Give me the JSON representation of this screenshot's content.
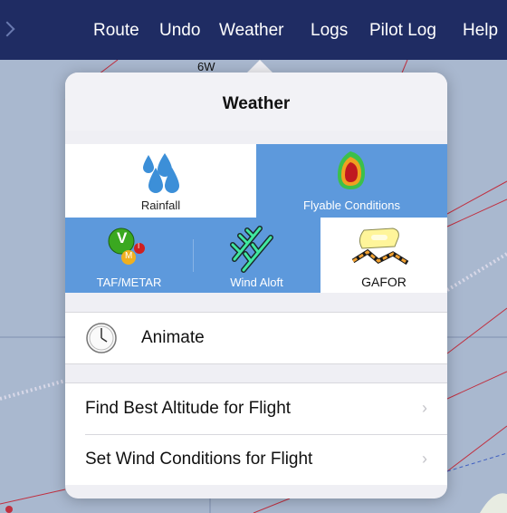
{
  "menu": {
    "items": [
      {
        "label": "Route"
      },
      {
        "label": "Undo"
      },
      {
        "label": "Weather"
      },
      {
        "label": "Logs"
      },
      {
        "label": "Pilot Log"
      },
      {
        "label": "Help"
      }
    ]
  },
  "map": {
    "label_6w": "6W"
  },
  "popover": {
    "title": "Weather",
    "tiles": {
      "rainfall": "Rainfall",
      "flyable": "Flyable Conditions",
      "taf_metar": "TAF/METAR",
      "wind_aloft": "Wind Aloft",
      "gafor": "GAFOR",
      "taf_v": "V",
      "taf_m": "M",
      "taf_i": "I"
    },
    "animate_label": "Animate",
    "rows": {
      "best_altitude": "Find Best Altitude for Flight",
      "wind_conditions": "Set Wind Conditions for Flight"
    },
    "chevron": "›"
  },
  "colors": {
    "topbar": "#1f2c63",
    "tile_selected": "#5d99dc",
    "map": "#a9b8cf"
  }
}
